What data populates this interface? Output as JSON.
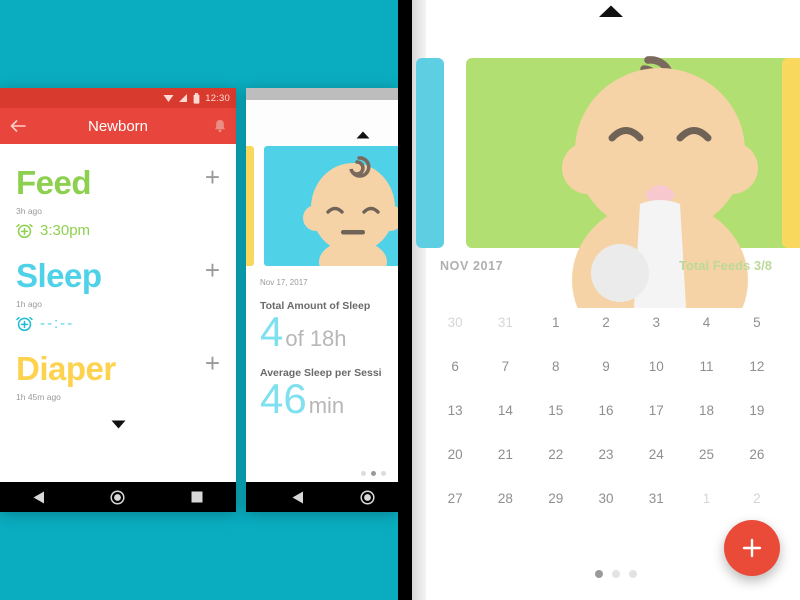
{
  "theme": {
    "background_teal": "#0aadc0",
    "accent_red": "#e8453c",
    "feed_green": "#8dd04f",
    "sleep_cyan": "#4fd2e8",
    "diaper_yellow": "#fdd24f",
    "fab_red": "#ea4a38"
  },
  "phone1": {
    "statusbar": {
      "time": "12:30",
      "icons": [
        "wifi-icon",
        "signal-icon",
        "battery-icon"
      ]
    },
    "appbar": {
      "title": "Newborn",
      "back_icon": "back-arrow-icon",
      "bell_icon": "notification-bell-icon"
    },
    "activities": [
      {
        "title": "Feed",
        "ago": "3h ago",
        "time": "3:30pm",
        "add_label": "+",
        "alarm_icon": "alarm-add-icon"
      },
      {
        "title": "Sleep",
        "ago": "1h ago",
        "time": "--:--",
        "add_label": "+",
        "alarm_icon": "alarm-add-icon"
      },
      {
        "title": "Diaper",
        "ago": "1h 45m ago",
        "time": "",
        "add_label": "+",
        "alarm_icon": ""
      }
    ],
    "expand_icon": "chevron-down-icon",
    "navbar": [
      "back-triangle-icon",
      "home-circle-icon",
      "recents-square-icon"
    ]
  },
  "phone2": {
    "up_icon": "chevron-up-icon",
    "date": "Nov 17, 2017",
    "stats": [
      {
        "label": "Total Amount of Sleep",
        "value": "4",
        "unit": "of 18h"
      },
      {
        "label": "Average Sleep per Sessi",
        "value": "46",
        "unit": "min"
      }
    ],
    "page_dots": {
      "count": 3,
      "active_index": 1
    },
    "navbar": [
      "back-triangle-icon",
      "home-circle-icon"
    ]
  },
  "right_panel": {
    "up_icon": "chevron-up-icon",
    "baby_illustration": "baby-with-bottle-illustration",
    "month": "NOV 2017",
    "feeds_label": "Total Feeds",
    "feeds_value": "3/8",
    "calendar": {
      "rows": [
        [
          {
            "d": "30",
            "muted": true
          },
          {
            "d": "31",
            "muted": true
          },
          {
            "d": "1"
          },
          {
            "d": "2"
          },
          {
            "d": "3"
          },
          {
            "d": "4"
          },
          {
            "d": "5"
          }
        ],
        [
          {
            "d": "6"
          },
          {
            "d": "7"
          },
          {
            "d": "8"
          },
          {
            "d": "9"
          },
          {
            "d": "10"
          },
          {
            "d": "11"
          },
          {
            "d": "12"
          }
        ],
        [
          {
            "d": "13"
          },
          {
            "d": "14"
          },
          {
            "d": "15"
          },
          {
            "d": "16"
          },
          {
            "d": "17"
          },
          {
            "d": "18"
          },
          {
            "d": "19"
          }
        ],
        [
          {
            "d": "20"
          },
          {
            "d": "21"
          },
          {
            "d": "22"
          },
          {
            "d": "23"
          },
          {
            "d": "24"
          },
          {
            "d": "25"
          },
          {
            "d": "26"
          }
        ],
        [
          {
            "d": "27"
          },
          {
            "d": "28"
          },
          {
            "d": "29"
          },
          {
            "d": "30"
          },
          {
            "d": "31"
          },
          {
            "d": "1",
            "muted": true
          },
          {
            "d": "2",
            "muted": true
          }
        ]
      ]
    },
    "page_dots": {
      "count": 3,
      "active_index": 0
    },
    "fab": {
      "icon": "plus-icon",
      "label": "+"
    }
  }
}
